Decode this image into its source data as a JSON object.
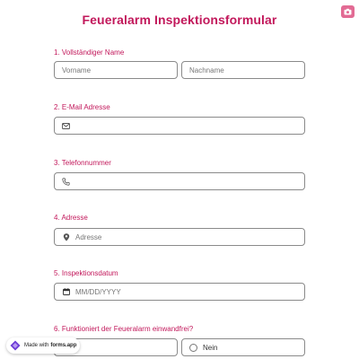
{
  "form": {
    "title": "Feueralarm Inspektionsformular"
  },
  "questions": {
    "q1": {
      "label": "1.  Vollständiger Name",
      "first_placeholder": "Vorname",
      "last_placeholder": "Nachname"
    },
    "q2": {
      "label": "2. E-Mail Adresse",
      "icon": "mail-icon"
    },
    "q3": {
      "label": "3. Telefonnummer",
      "icon": "phone-icon"
    },
    "q4": {
      "label": "4. Adresse",
      "placeholder": "Adresse",
      "icon": "location-pin-icon"
    },
    "q5": {
      "label": "5. Inspektionsdatum",
      "placeholder": "MM/DD/YYYY",
      "icon": "calendar-icon"
    },
    "q6": {
      "label": "6. Funktioniert der Feueralarm einwandfrei?",
      "option_no": "Nein"
    }
  },
  "branding": {
    "made_with": "Made with",
    "brand": "forms.app"
  },
  "colors": {
    "accent": "#c2185b",
    "border": "#8a8a8a",
    "corner_button": "#e26b94"
  }
}
